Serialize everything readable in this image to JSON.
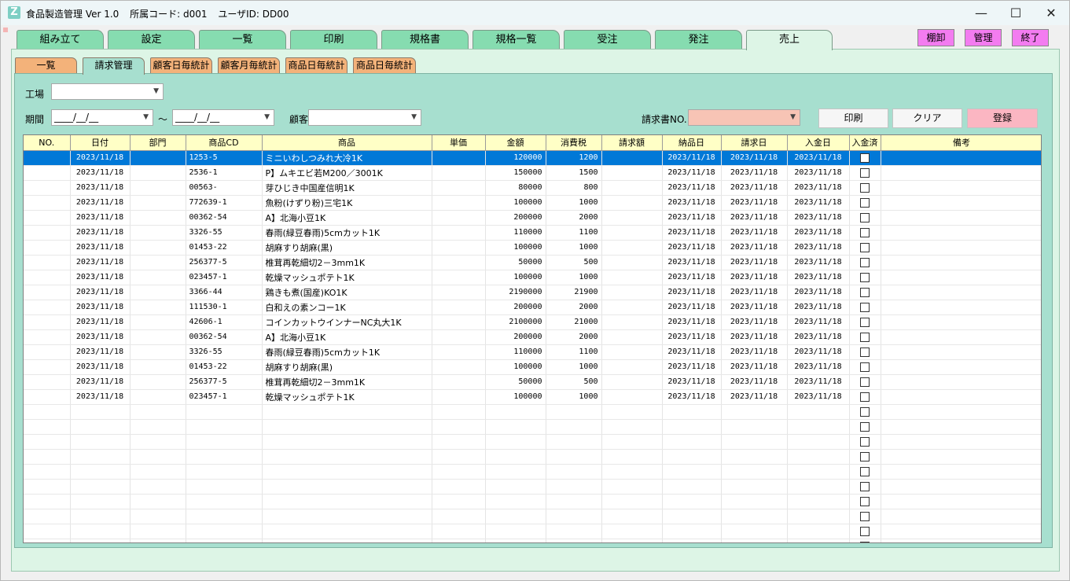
{
  "window": {
    "app_name": "食品製造管理 Ver 1.0",
    "dept_code": "所属コード: d001",
    "user_id": "ユーザID: DD00",
    "minimize": "—",
    "maximize": "☐",
    "close": "✕",
    "app_icon": "Z"
  },
  "main_tabs": [
    "組み立て",
    "設定",
    "一覧",
    "印刷",
    "規格書",
    "規格一覧",
    "受注",
    "発注",
    "売上"
  ],
  "right_buttons": [
    "棚卸",
    "管理",
    "終了"
  ],
  "sub_tabs": [
    "一覧",
    "請求管理",
    "顧客日毎統計",
    "顧客月毎統計",
    "商品日毎統計",
    "商品日毎統計"
  ],
  "form": {
    "factory_label": "工場",
    "factory_value": "",
    "period_label": "期間",
    "period_from": "____/__/__",
    "period_tilde": "～",
    "period_to": "____/__/__",
    "customer_label": "顧客",
    "customer_value": "",
    "invoice_no_label": "請求書NO.",
    "invoice_no_value": "",
    "print_button": "印刷",
    "clear_button": "クリア",
    "register_button": "登録"
  },
  "colors": {
    "selected_row": "#0078d7",
    "main_tab": "#86dcb0",
    "sub_tab": "#f3b27a",
    "magenta_button": "#f37cf0",
    "register_button": "#fbb6c2",
    "invoice_combo": "#f7c4b5"
  },
  "table": {
    "columns": [
      "NO.",
      "日付",
      "部門",
      "商品CD",
      "商品",
      "単価",
      "金額",
      "消費税",
      "請求額",
      "納品日",
      "請求日",
      "入金日",
      "入金済",
      "備考"
    ],
    "rows": [
      [
        "",
        "2023/11/18",
        "",
        "1253-5",
        "ミニいわしつみれ大冷1K",
        "",
        "120000",
        "1200",
        "",
        "2023/11/18",
        "2023/11/18",
        "2023/11/18"
      ],
      [
        "",
        "2023/11/18",
        "",
        "2536-1",
        "P】ムキエビ若M200／3001K",
        "",
        "150000",
        "1500",
        "",
        "2023/11/18",
        "2023/11/18",
        "2023/11/18"
      ],
      [
        "",
        "2023/11/18",
        "",
        "00563-",
        "芽ひじき中国産信明1K",
        "",
        "80000",
        "800",
        "",
        "2023/11/18",
        "2023/11/18",
        "2023/11/18"
      ],
      [
        "",
        "2023/11/18",
        "",
        "772639-1",
        "魚粉(けずり粉)三宅1K",
        "",
        "100000",
        "1000",
        "",
        "2023/11/18",
        "2023/11/18",
        "2023/11/18"
      ],
      [
        "",
        "2023/11/18",
        "",
        "00362-54",
        "A】北海小豆1K",
        "",
        "200000",
        "2000",
        "",
        "2023/11/18",
        "2023/11/18",
        "2023/11/18"
      ],
      [
        "",
        "2023/11/18",
        "",
        "3326-55",
        "春雨(緑豆春雨)5cmカット1K",
        "",
        "110000",
        "1100",
        "",
        "2023/11/18",
        "2023/11/18",
        "2023/11/18"
      ],
      [
        "",
        "2023/11/18",
        "",
        "01453-22",
        "胡麻すり胡麻(黒)",
        "",
        "100000",
        "1000",
        "",
        "2023/11/18",
        "2023/11/18",
        "2023/11/18"
      ],
      [
        "",
        "2023/11/18",
        "",
        "256377-5",
        "椎茸再乾細切2－3mm1K",
        "",
        "50000",
        "500",
        "",
        "2023/11/18",
        "2023/11/18",
        "2023/11/18"
      ],
      [
        "",
        "2023/11/18",
        "",
        "023457-1",
        "乾燥マッシュポテト1K",
        "",
        "100000",
        "1000",
        "",
        "2023/11/18",
        "2023/11/18",
        "2023/11/18"
      ],
      [
        "",
        "2023/11/18",
        "",
        "3366-44",
        "鶏きも煮(国産)KO1K",
        "",
        "2190000",
        "21900",
        "",
        "2023/11/18",
        "2023/11/18",
        "2023/11/18"
      ],
      [
        "",
        "2023/11/18",
        "",
        "111530-1",
        "白和えの素ンコー1K",
        "",
        "200000",
        "2000",
        "",
        "2023/11/18",
        "2023/11/18",
        "2023/11/18"
      ],
      [
        "",
        "2023/11/18",
        "",
        "42606-1",
        "コインカットウインナーNC丸大1K",
        "",
        "2100000",
        "21000",
        "",
        "2023/11/18",
        "2023/11/18",
        "2023/11/18"
      ],
      [
        "",
        "2023/11/18",
        "",
        "00362-54",
        "A】北海小豆1K",
        "",
        "200000",
        "2000",
        "",
        "2023/11/18",
        "2023/11/18",
        "2023/11/18"
      ],
      [
        "",
        "2023/11/18",
        "",
        "3326-55",
        "春雨(緑豆春雨)5cmカット1K",
        "",
        "110000",
        "1100",
        "",
        "2023/11/18",
        "2023/11/18",
        "2023/11/18"
      ],
      [
        "",
        "2023/11/18",
        "",
        "01453-22",
        "胡麻すり胡麻(黒)",
        "",
        "100000",
        "1000",
        "",
        "2023/11/18",
        "2023/11/18",
        "2023/11/18"
      ],
      [
        "",
        "2023/11/18",
        "",
        "256377-5",
        "椎茸再乾細切2－3mm1K",
        "",
        "50000",
        "500",
        "",
        "2023/11/18",
        "2023/11/18",
        "2023/11/18"
      ],
      [
        "",
        "2023/11/18",
        "",
        "023457-1",
        "乾燥マッシュポテト1K",
        "",
        "100000",
        "1000",
        "",
        "2023/11/18",
        "2023/11/18",
        "2023/11/18"
      ]
    ],
    "empty_rows": 10,
    "selected_row": 0
  }
}
